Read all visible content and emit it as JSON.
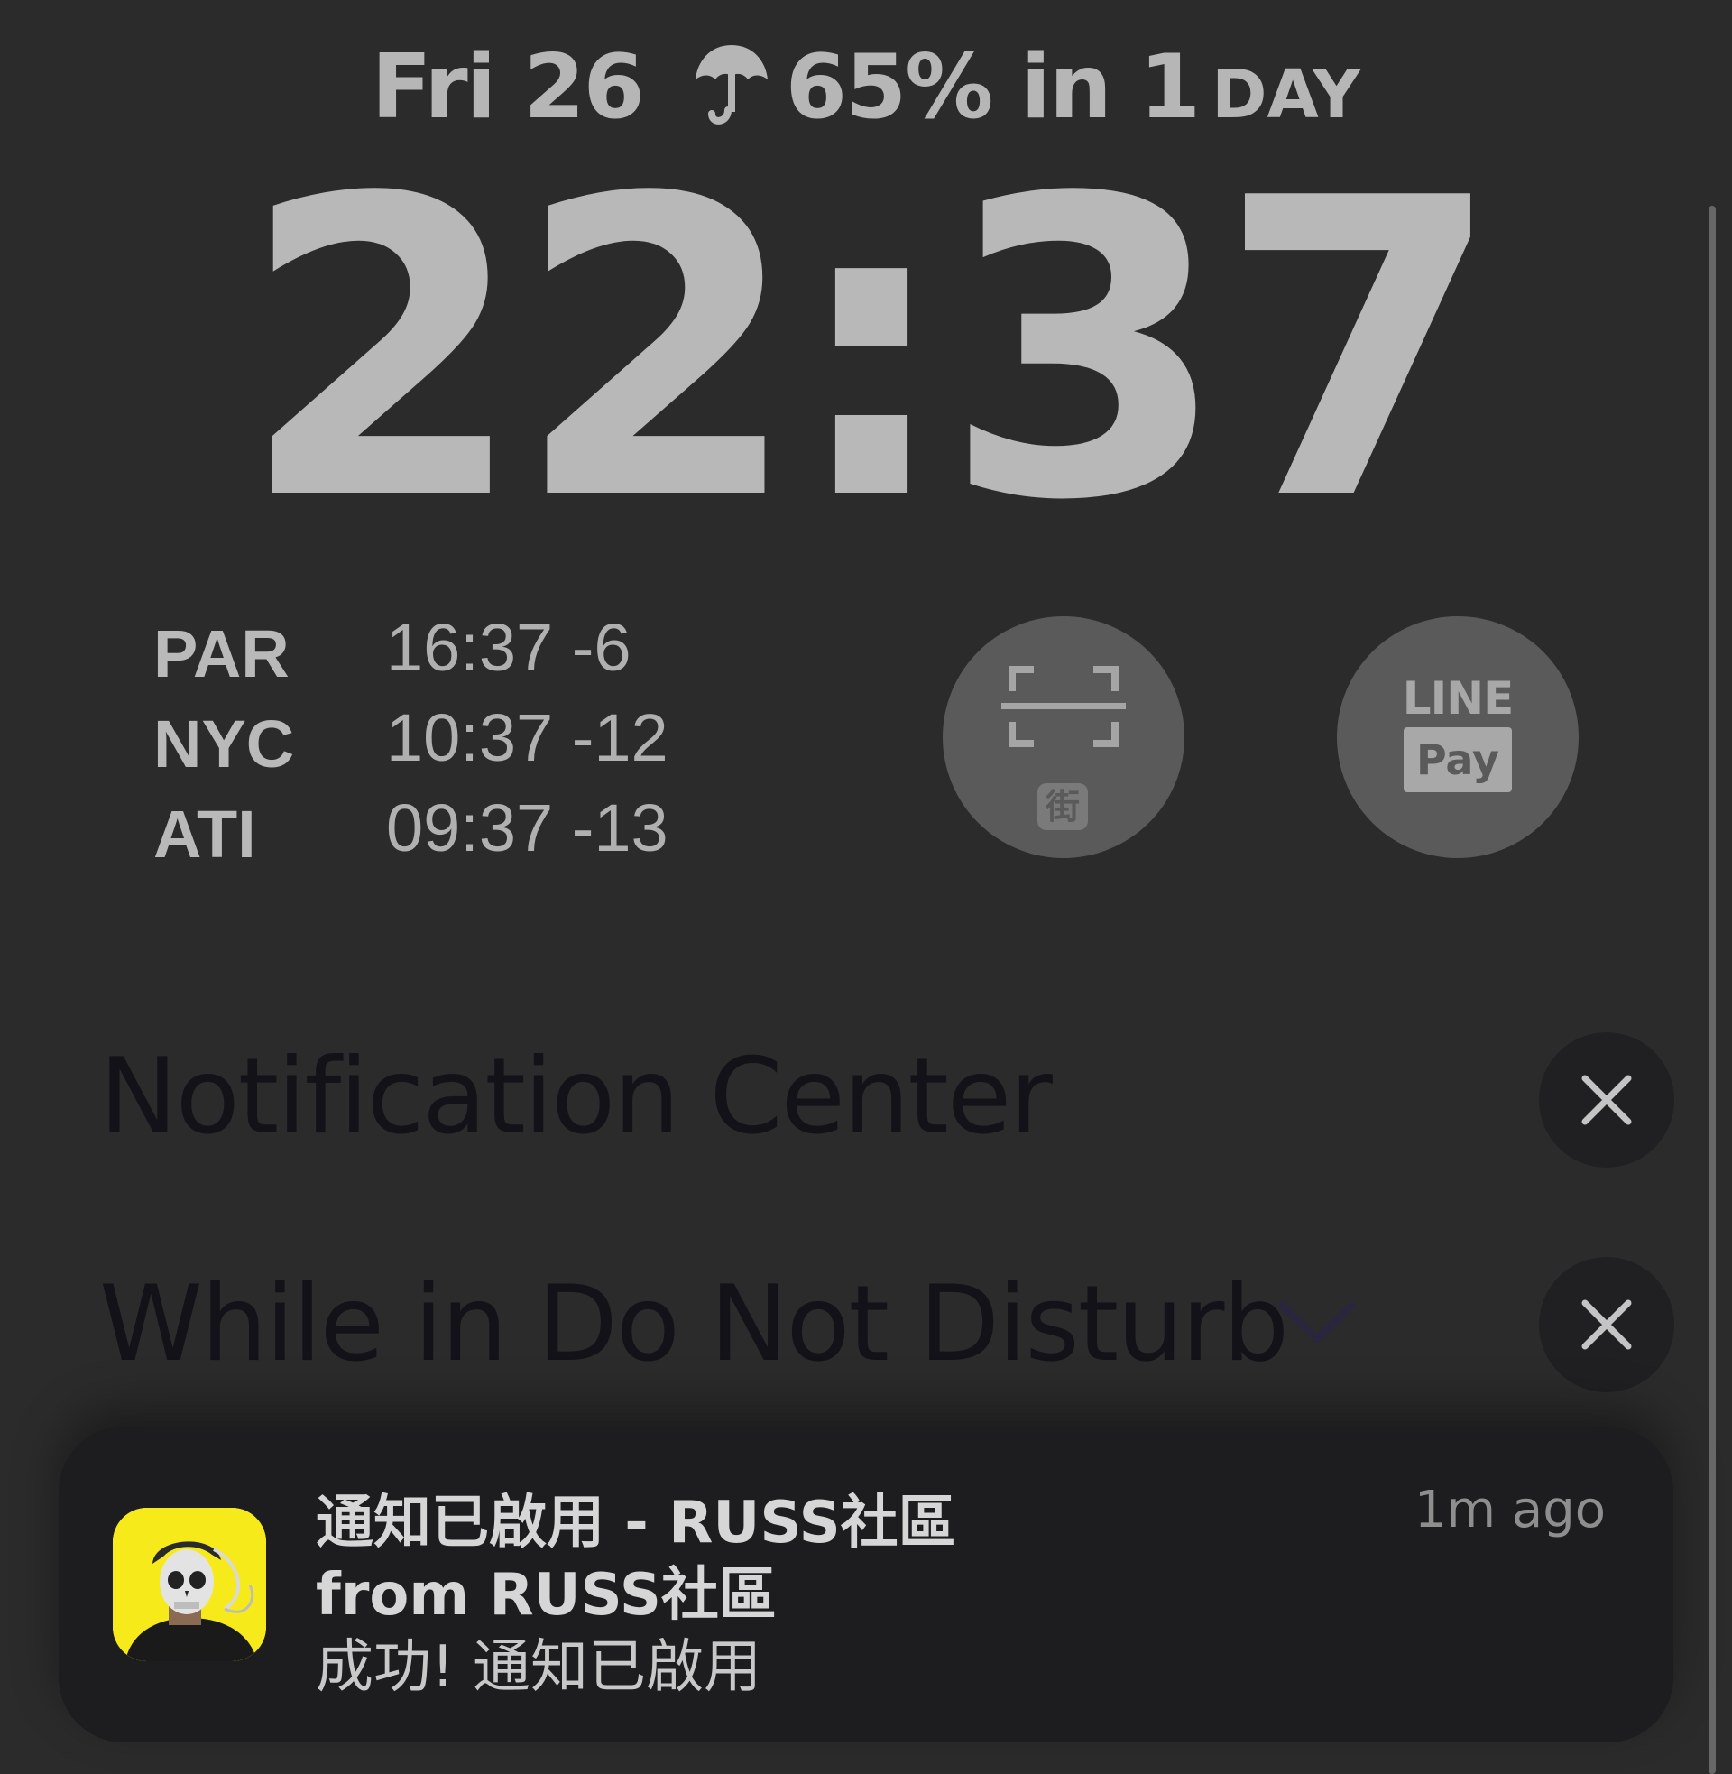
{
  "lockscreen": {
    "date": "Fri 26",
    "weather_icon": "umbrella-icon",
    "weather_value": "65% in 1",
    "weather_unit": "DAY",
    "time": "22:37"
  },
  "world_clock": {
    "rows": [
      {
        "city": "PAR",
        "time": "16:37 -6"
      },
      {
        "city": "NYC",
        "time": "10:37 -12"
      },
      {
        "city": "ATI",
        "time": "09:37 -13"
      }
    ]
  },
  "shortcuts": {
    "scan": {
      "icon": "scan-icon",
      "badge": "街"
    },
    "line_pay": {
      "line": "LINE",
      "pay": "Pay"
    }
  },
  "notification_center": {
    "title": "Notification Center",
    "dnd_title": "While in Do Not Disturb",
    "close_icon": "close-icon",
    "chevron_icon": "chevron-down-icon"
  },
  "notification": {
    "app_icon": "app-avatar-icon",
    "title": "通知已啟用 - RUSS社區",
    "subtitle": "from RUSS社區",
    "body": "成功! 通知已啟用",
    "time": "1m ago"
  },
  "colors": {
    "background": "#2b2b2c",
    "text_muted": "#b4b4b4",
    "card_background": "#1d1d1f",
    "app_icon_yellow": "#f6ea1b"
  }
}
